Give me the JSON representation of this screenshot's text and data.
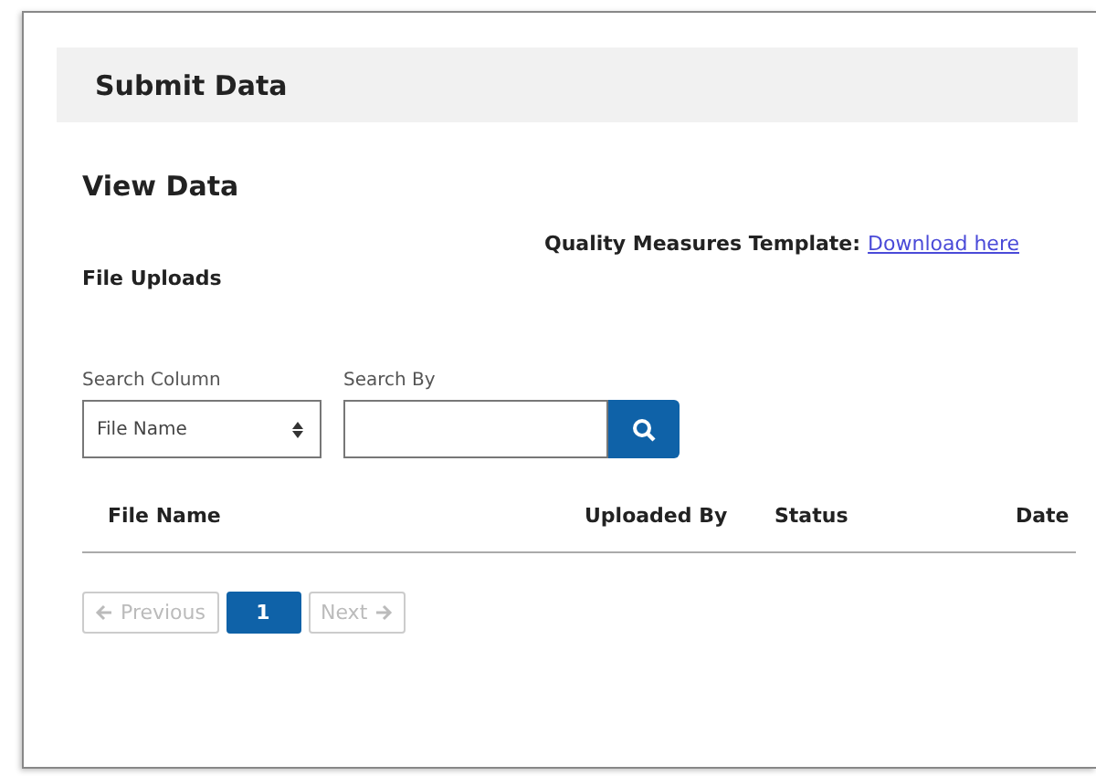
{
  "header": {
    "title": "Submit Data"
  },
  "section": {
    "title": "View Data",
    "subtitle": "File Uploads",
    "template_label": "Quality Measures Template:",
    "template_link": "Download here"
  },
  "search": {
    "column_label": "Search Column",
    "column_value": "File Name",
    "by_label": "Search By"
  },
  "table": {
    "columns": [
      "File Name",
      "Uploaded By",
      "Status",
      "Date"
    ]
  },
  "pagination": {
    "previous": {
      "label": "Previous",
      "disabled": true
    },
    "pages": [
      {
        "label": "1",
        "selected": true
      }
    ],
    "next": {
      "label": "Next",
      "disabled": true
    }
  }
}
